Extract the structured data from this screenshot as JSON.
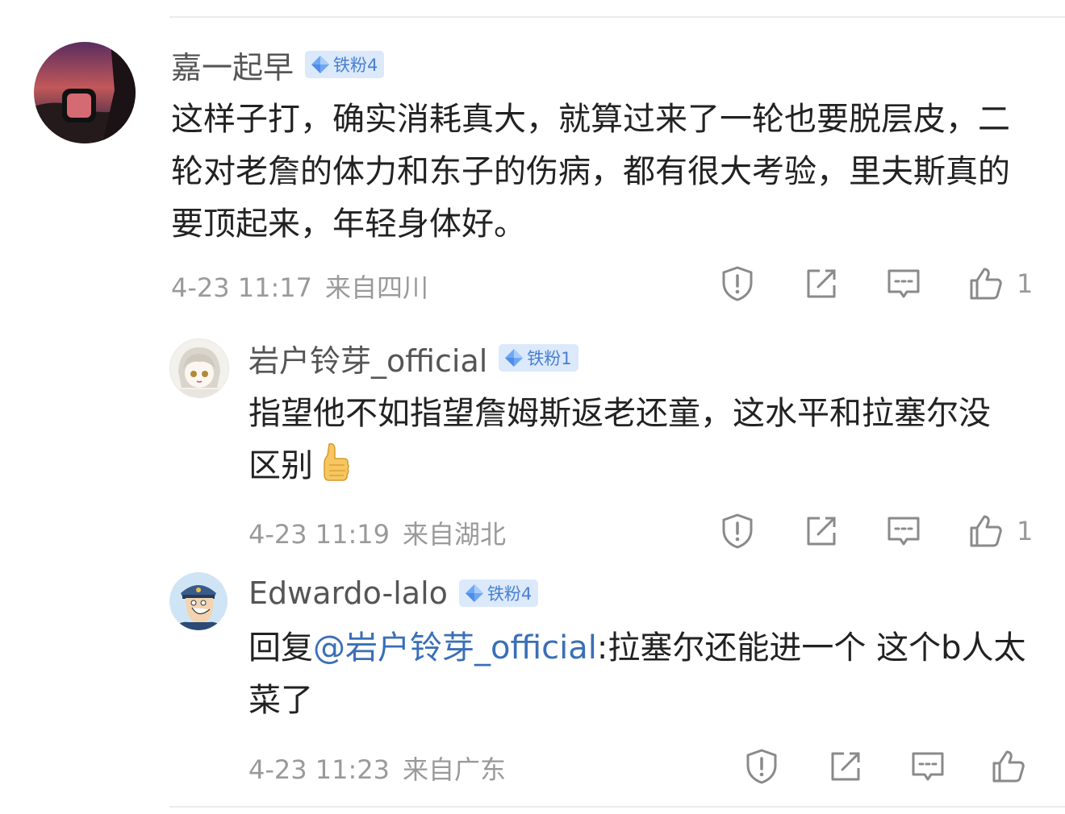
{
  "comments": [
    {
      "username": "嘉一起早",
      "badge": "铁粉4",
      "content": "这样子打，确实消耗真大，就算过来了一轮也要脱层皮，二轮对老詹的体力和东子的伤病，都有很大考验，里夫斯真的要顶起来，年轻身体好。",
      "time": "4-23 11:17",
      "location": "来自四川",
      "likes": "1"
    },
    {
      "username": "岩户铃芽_official",
      "badge": "铁粉1",
      "content": "指望他不如指望詹姆斯返老还童，这水平和拉塞尔没区别",
      "emoji": "thumbs-up",
      "time": "4-23 11:19",
      "location": "来自湖北",
      "likes": "1"
    },
    {
      "username": "Edwardo-lalo",
      "badge": "铁粉4",
      "reply_prefix": "回复",
      "mention": "@岩户铃芽_official",
      "content": ":拉塞尔还能进一个  这个b人太菜了",
      "time": "4-23 11:23",
      "location": "来自广东",
      "likes": ""
    }
  ],
  "icons": {
    "report": "report-icon",
    "share": "share-icon",
    "reply": "comment-icon",
    "like": "thumbs-up-icon"
  },
  "colors": {
    "mention": "#3a6fb7",
    "badge_bg": "#dbe9fb",
    "badge_text": "#4a7fd0",
    "meta": "#9a9a9a"
  }
}
